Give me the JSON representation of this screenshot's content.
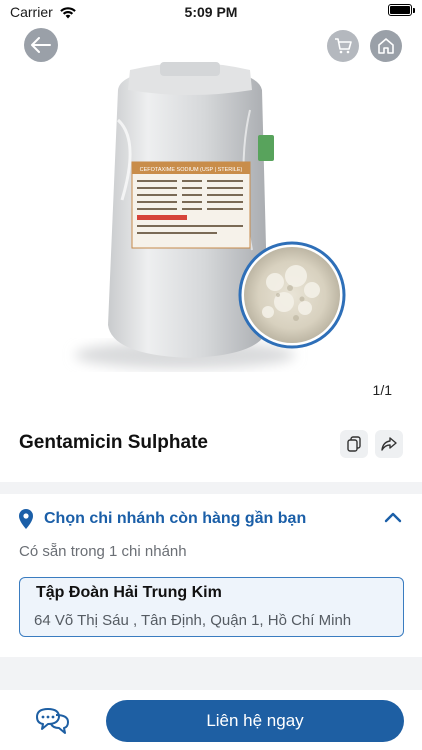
{
  "status_bar": {
    "carrier": "Carrier",
    "time": "5:09 PM"
  },
  "nav": {
    "back_icon": "arrow-left-icon",
    "cart_icon": "cart-icon",
    "home_icon": "home-icon"
  },
  "gallery": {
    "counter": "1/1",
    "label_text": "CEFOTAXIME SODIUM (USP | STERILE)"
  },
  "product": {
    "title": "Gentamicin Sulphate",
    "copy_icon": "copy-icon",
    "share_icon": "share-icon"
  },
  "branches": {
    "section_title": "Chọn chi nhánh còn hàng gần bạn",
    "availability": "Có sẵn trong 1 chi nhánh",
    "items": [
      {
        "name": "Tập Đoàn Hải Trung Kim",
        "address": "64 Võ Thị Sáu , Tân Định, Quận 1, Hồ Chí Minh"
      }
    ]
  },
  "bottom": {
    "chat_icon": "chat-icon",
    "contact_label": "Liên hệ ngay"
  },
  "colors": {
    "brand_blue": "#1e5fa3",
    "section_title_blue": "#1b5fa8",
    "card_border": "#3a7cc0",
    "card_bg": "#eef4fb"
  }
}
